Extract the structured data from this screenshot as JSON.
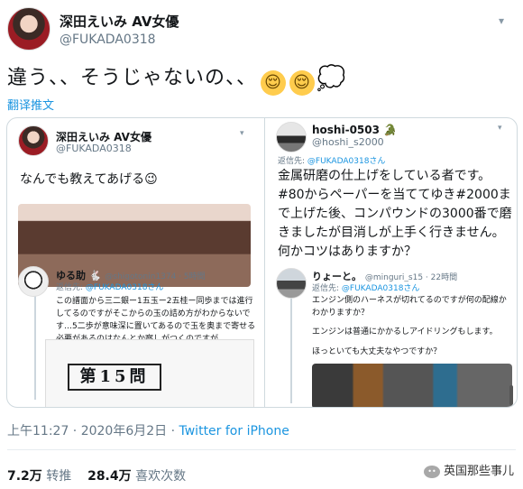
{
  "author": {
    "display_name": "深田えいみ AV女優",
    "handle": "@FUKADA0318",
    "menu_icon": "chevron-down-icon"
  },
  "tweet": {
    "text": "違う、、そうじゃないの、、",
    "emoji_1": "😌",
    "emoji_2": "😌",
    "emoji_3": "💭",
    "translate_label": "翻译推文"
  },
  "embedded_left": {
    "name": "深田えいみ AV女優",
    "handle": "@FUKADA0318",
    "text": "なんでも教えてあげる😉",
    "reply": {
      "name": "ゆる助",
      "badge": "🐇",
      "meta": "@shigotonin1374 · 5時間",
      "reply_to_prefix": "返信先:",
      "reply_to": "@FUKADA0318さん",
      "text": "この譜面から三二銀ー1五玉ー2五桂ー同歩までは進行してるのですがそこからの玉の詰め方がわからないです…5二歩が意味深に置いてあるので玉を奥まで寄せる必要があるのはなんとか察しがつくのですが…",
      "doc_title": "第15問"
    }
  },
  "embedded_right": {
    "name": "hoshi-0503",
    "badge": "🐊",
    "handle": "@hoshi_s2000",
    "reply_to_prefix": "返信先:",
    "reply_to": "@FUKADA0318さん",
    "text": "金属研磨の仕上げをしている者です。#80からペーパーを当ててゆき#2000まで上げた後、コンパウンドの3000番で磨きましたが目消しが上手く行きません。何かコツはありますか？",
    "reply": {
      "name": "りょーと。",
      "meta": "@minguri_s15 · 22時間",
      "reply_to_prefix": "返信先:",
      "reply_to": "@FUKADA0318さん",
      "line1": "エンジン側のハーネスが切れてるのですが何の配線かわかりますか？",
      "line2": "エンジンは普通にかかるしアイドリングもします。",
      "line3": "ほっといても大丈夫なやつですか？"
    }
  },
  "footer": {
    "timestamp": "上午11:27 · 2020年6月2日 · ",
    "via": "Twitter for iPhone",
    "retweets_value": "7.2万",
    "retweets_label": "转推",
    "likes_value": "28.4万",
    "likes_label": "喜欢次数"
  },
  "watermark": {
    "icon": "wechat-icon",
    "text": "英国那些事儿"
  }
}
